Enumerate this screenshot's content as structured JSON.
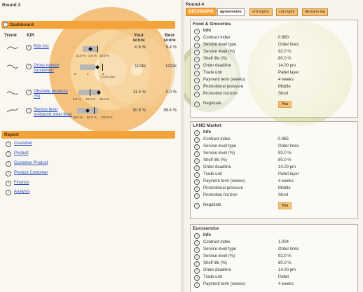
{
  "left": {
    "round_title": "Round 3",
    "dashboard_title": "Dashboard",
    "headers": {
      "trend": "Trend",
      "kpi": "KPI",
      "your_score": "Your\nscore",
      "best_score": "Best\nscore"
    },
    "kpis": [
      {
        "label": "ROI (%)",
        "your": "-0.6 %",
        "best": "9.4 %",
        "gauge_labels": [
          "15.0 %",
          "-2.5 %",
          "10.0 %"
        ],
        "gauge_sub": ""
      },
      {
        "label": "Gross margin (customer)",
        "your": "1104k",
        "best": "1422k",
        "gauge_labels": [
          "0",
          "1",
          "2"
        ],
        "gauge_sub": "k 1000 (000)"
      },
      {
        "label": "Obsolete products (%)",
        "your": "11.4 %",
        "best": "0.0 %",
        "gauge_labels": [
          "0.0 %",
          "10.0 %",
          "20.0 %"
        ],
        "gauge_sub": ""
      },
      {
        "label": "Service level outbound order lines",
        "your": "90.6 %",
        "best": "99.4 %",
        "gauge_labels": [
          "35.0 %",
          "92.5 %",
          "100.0 %"
        ],
        "gauge_sub": ""
      }
    ],
    "report_title": "Report",
    "report_links": [
      "Customer",
      "Product",
      "Customer Product",
      "Product Customer",
      "Finance",
      "Analysis"
    ]
  },
  "right": {
    "round_title": "Round 4",
    "tabs": [
      "DECISIONS",
      "agreements",
      "ord.mgmt.",
      "cat.mgmt",
      "decision log"
    ],
    "markets": [
      {
        "name": "Food & Groceries",
        "info_label": "Info",
        "rows": [
          {
            "k": "Contract index",
            "v": "0.960"
          },
          {
            "k": "Service level type",
            "v": "Order lines"
          },
          {
            "k": "Service level (%)",
            "v": "92.0 %"
          },
          {
            "k": "Shelf life (%)",
            "v": "80.0 %"
          },
          {
            "k": "Order deadline",
            "v": "14.00 pm"
          },
          {
            "k": "Trade unit",
            "v": "Pallet layer"
          },
          {
            "k": "Payment term (weeks)",
            "v": "4 weeks"
          },
          {
            "k": "Promotional pressure",
            "v": "Middle"
          },
          {
            "k": "Promotion horizon",
            "v": "Short"
          }
        ],
        "negotiate_label": "Negotiate",
        "yes_label": "Yes"
      },
      {
        "name": "LAND Market",
        "info_label": "Info",
        "rows": [
          {
            "k": "Contract index",
            "v": "0.965"
          },
          {
            "k": "Service level type",
            "v": "Order lines"
          },
          {
            "k": "Service level (%)",
            "v": "93.0 %"
          },
          {
            "k": "Shelf life (%)",
            "v": "80.0 %"
          },
          {
            "k": "Order deadline",
            "v": "14.00 pm"
          },
          {
            "k": "Trade unit",
            "v": "Pallet layer"
          },
          {
            "k": "Payment term (weeks)",
            "v": "4 weeks"
          },
          {
            "k": "Promotional pressure",
            "v": "Middle"
          },
          {
            "k": "Promotion horizon",
            "v": "Short"
          }
        ],
        "negotiate_label": "Negotiate",
        "yes_label": "Yes"
      },
      {
        "name": "Euroservice",
        "info_label": "Info",
        "rows": [
          {
            "k": "Contract index",
            "v": "1.004"
          },
          {
            "k": "Service level type",
            "v": "Order lines"
          },
          {
            "k": "Service level (%)",
            "v": "92.0 %"
          },
          {
            "k": "Shelf life (%)",
            "v": "80.0 %"
          },
          {
            "k": "Order deadline",
            "v": "14.00 pm"
          },
          {
            "k": "Trade unit",
            "v": "Pallet"
          },
          {
            "k": "Payment term (weeks)",
            "v": "4 weeks"
          }
        ]
      }
    ]
  },
  "colors": {
    "accent": "#f4a33a",
    "link": "#2b4fbf",
    "tab": "#f6c27a"
  },
  "icons": {
    "info": "info-icon",
    "trend": "sparkline-icon",
    "gauge_marker": "diamond-icon"
  }
}
